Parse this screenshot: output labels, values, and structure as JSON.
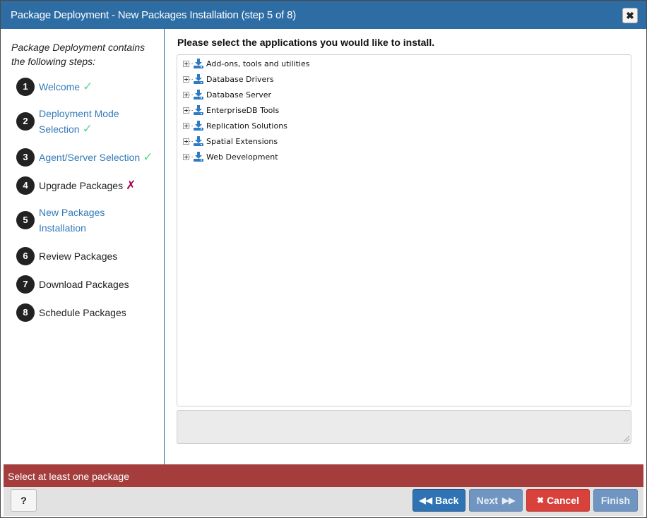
{
  "dialog": {
    "title": "Package Deployment - New Packages Installation (step 5 of 8)",
    "close_glyph": "✖"
  },
  "steps": {
    "intro": "Package Deployment contains the following steps:",
    "items": [
      {
        "num": "1",
        "label": "Welcome",
        "status": "done"
      },
      {
        "num": "2",
        "label": "Deployment Mode Selection",
        "status": "done"
      },
      {
        "num": "3",
        "label": "Agent/Server Selection",
        "status": "done"
      },
      {
        "num": "4",
        "label": "Upgrade Packages",
        "status": "failed"
      },
      {
        "num": "5",
        "label": "New Packages Installation",
        "status": "current"
      },
      {
        "num": "6",
        "label": "Review Packages",
        "status": "todo"
      },
      {
        "num": "7",
        "label": "Download Packages",
        "status": "todo"
      },
      {
        "num": "8",
        "label": "Schedule Packages",
        "status": "todo"
      }
    ],
    "check_glyph": "✓",
    "x_glyph": "✗"
  },
  "content": {
    "heading": "Please select the applications you would like to install.",
    "tree": [
      "Add-ons, tools and utilities",
      "Database Drivers",
      "Database Server",
      "EnterpriseDB Tools",
      "Replication Solutions",
      "Spatial Extensions",
      "Web Development"
    ],
    "notes_value": ""
  },
  "status": {
    "error": "Select at least one package"
  },
  "buttons": {
    "help": "?",
    "back": "Back",
    "next": "Next",
    "cancel": "Cancel",
    "finish": "Finish"
  },
  "colors": {
    "titlebar": "#2e6da4",
    "error_bar": "#a53d3d",
    "back": "#2f73b4",
    "cancel": "#d9413b",
    "disabled": "#6f95c0",
    "check": "#5cd68f",
    "cross": "#a3004f"
  }
}
